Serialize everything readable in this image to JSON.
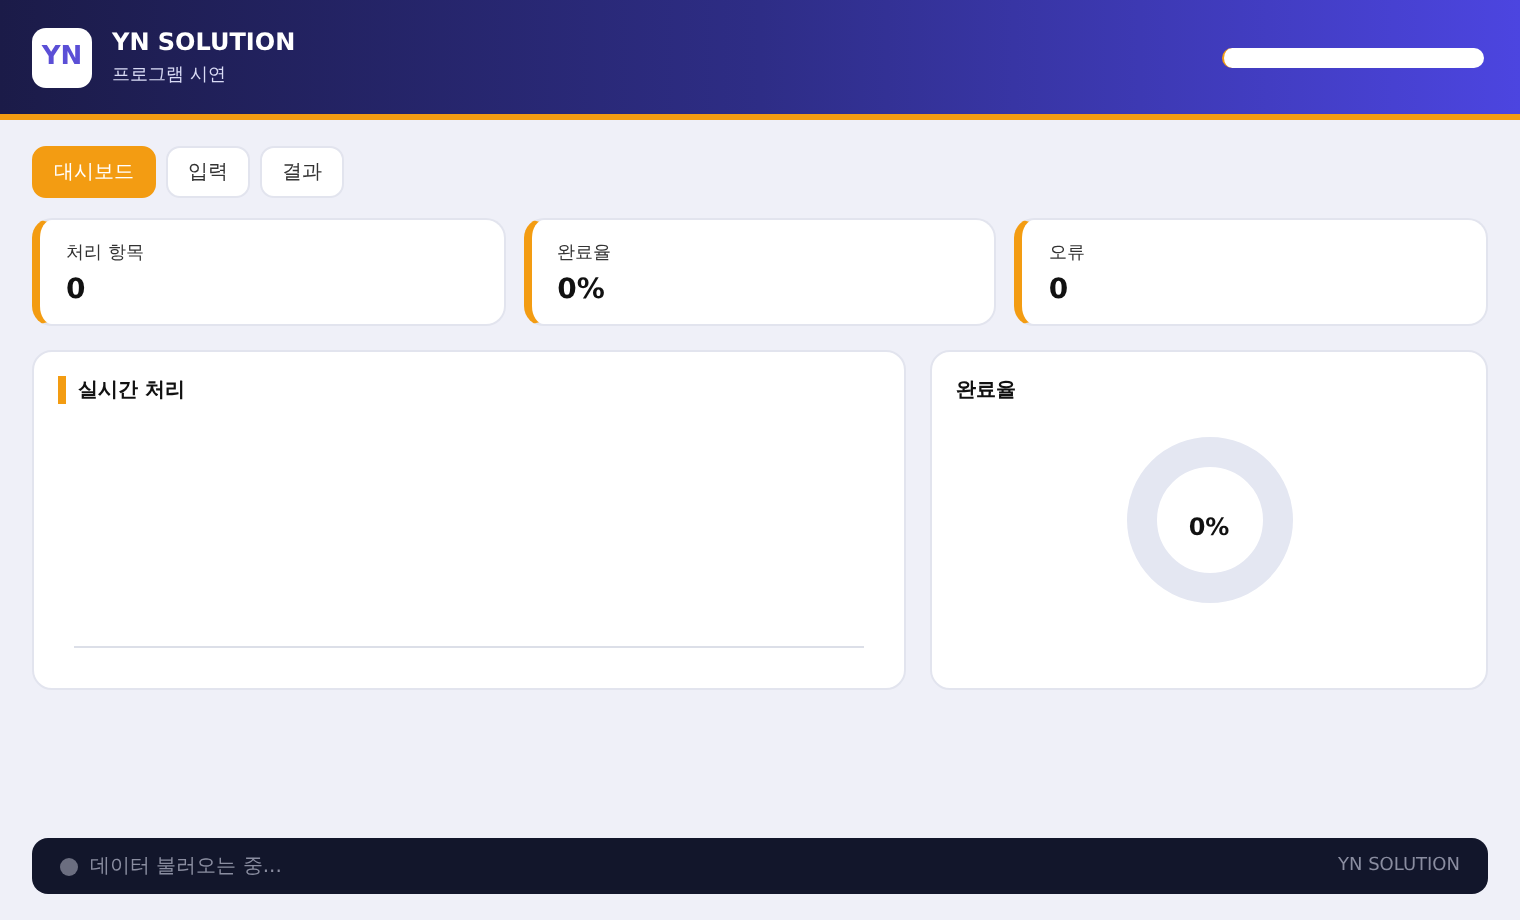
{
  "header": {
    "logo": "YN",
    "title": "YN SOLUTION",
    "subtitle": "프로그램 시연",
    "progress": {
      "level": 0
    }
  },
  "tabs": [
    {
      "label": "대시보드",
      "selected": true
    },
    {
      "label": "입력",
      "selected": false
    },
    {
      "label": "결과",
      "selected": false
    }
  ],
  "stats": [
    {
      "label": "처리 항목",
      "value": "0"
    },
    {
      "label": "완료율",
      "value": "0%"
    },
    {
      "label": "오류",
      "value": "0"
    }
  ],
  "realtime_panel": {
    "title": "실시간 처리"
  },
  "completion_panel": {
    "title": "완료율",
    "center_text": "0%",
    "level": 0
  },
  "status_bar": {
    "message": "데이터 불러오는 중...",
    "brand": "YN SOLUTION"
  }
}
